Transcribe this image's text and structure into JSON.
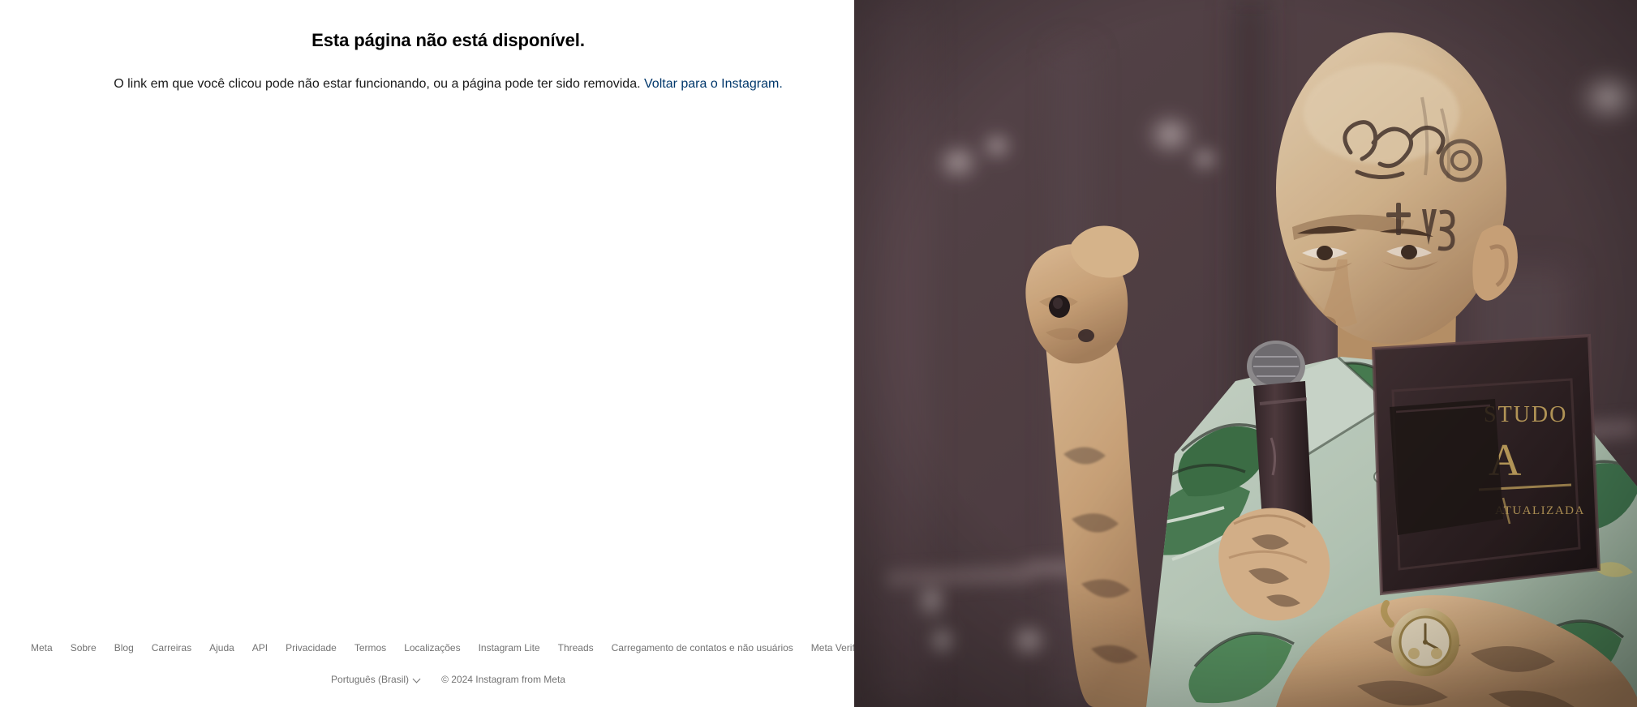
{
  "page": {
    "title": "Esta página não está disponível.",
    "message_prefix": "O link em que você clicou pode não estar funcionando, ou a página pode ter sido removida.",
    "link_label": "Voltar para o Instagram."
  },
  "footer": {
    "links": [
      {
        "label": "Meta"
      },
      {
        "label": "Sobre"
      },
      {
        "label": "Blog"
      },
      {
        "label": "Carreiras"
      },
      {
        "label": "Ajuda"
      },
      {
        "label": "API"
      },
      {
        "label": "Privacidade"
      },
      {
        "label": "Termos"
      },
      {
        "label": "Localizações"
      },
      {
        "label": "Instagram Lite"
      },
      {
        "label": "Threads"
      },
      {
        "label": "Carregamento de contatos e não usuários"
      },
      {
        "label": "Meta Verif"
      }
    ],
    "language": "Português (Brasil)",
    "copyright": "© 2024 Instagram from Meta"
  },
  "photo": {
    "alt": "Homem careca com tatuagens no rosto e na cabeça segurando um microfone e uma Bíblia, com a mão direita erguida em um palco",
    "book_text_1": "STUDO",
    "book_text_2": "A",
    "book_text_3": "ATUALIZADA"
  },
  "colors": {
    "link": "#00376b",
    "footer_text": "#737373",
    "title": "#000000",
    "body_text": "#1a1a1a",
    "photo_background": "#4a3b41",
    "shirt_green": "#4f8a5c",
    "shirt_light": "#c3d6c8",
    "skin": "#d9b48c",
    "book_dark": "#2b2023",
    "gold": "#c9a95f"
  }
}
